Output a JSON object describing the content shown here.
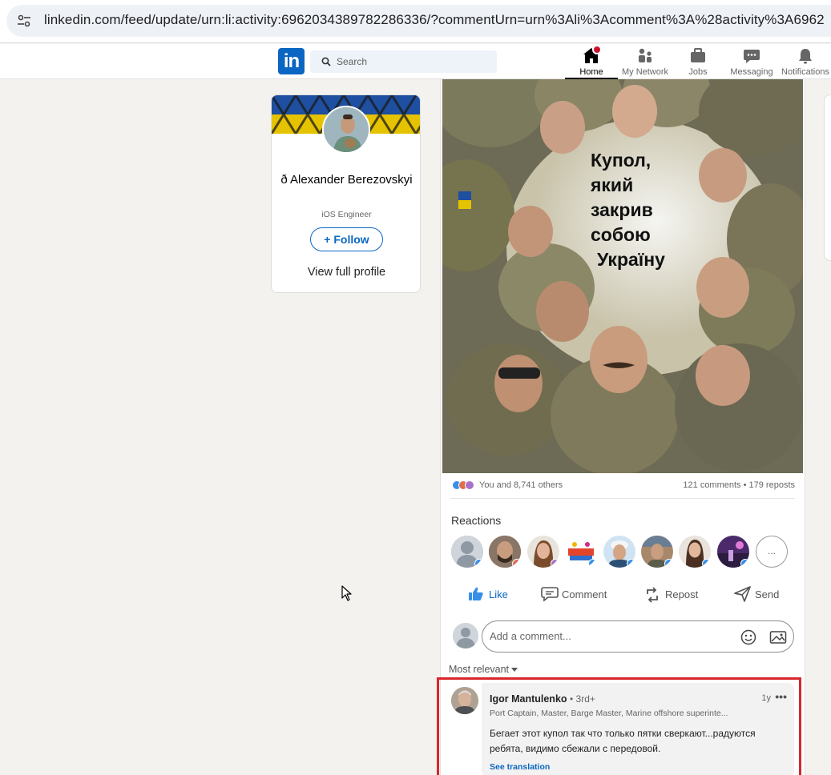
{
  "browser": {
    "url": "linkedin.com/feed/update/urn:li:activity:6962034389782286336/?commentUrn=urn%3Ali%3Acomment%3A%28activity%3A6962"
  },
  "nav": {
    "search_placeholder": "Search",
    "items": [
      {
        "label": "Home",
        "icon": "home-icon",
        "active": true
      },
      {
        "label": "My Network",
        "icon": "network-icon"
      },
      {
        "label": "Jobs",
        "icon": "briefcase-icon"
      },
      {
        "label": "Messaging",
        "icon": "messaging-icon"
      },
      {
        "label": "Notifications",
        "icon": "bell-icon"
      }
    ],
    "brand_color": "#0a66c2"
  },
  "profile_card": {
    "name": "ð Alexander Berezovskyi",
    "title": "iOS Engineer",
    "follow_label": "+ Follow",
    "view_profile_label": "View full profile"
  },
  "post": {
    "image_caption_lines": [
      "Купол,",
      "який",
      "закрив",
      "собою",
      "Україну"
    ],
    "reactions_summary": "You and 8,741 others",
    "comments_reposts": "121 comments • 179 reposts",
    "reactions_title": "Reactions",
    "more_reactions_label": "...",
    "actions": {
      "like": "Like",
      "comment": "Comment",
      "repost": "Repost",
      "send": "Send"
    },
    "comment_placeholder": "Add a comment...",
    "sort_label": "Most relevant"
  },
  "highlighted_comment": {
    "author": "Igor Mantulenko",
    "degree": "• 3rd+",
    "headline": "Port Captain, Master, Barge Master, Marine offshore superinte...",
    "time": "1y",
    "more": "•••",
    "text": "Бегает этот купол так что только пятки сверкают...радуются ребята, видимо сбежали с передовой.",
    "translate_label": "See translation",
    "highlight_color": "#d8262c"
  }
}
